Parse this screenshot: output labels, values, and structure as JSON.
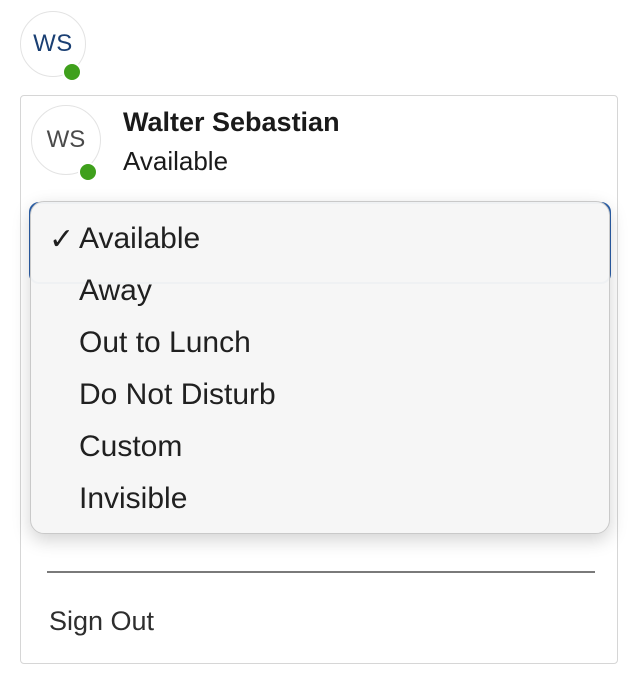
{
  "header": {
    "avatar_initials": "WS",
    "status_color": "#3fa01c"
  },
  "profile": {
    "avatar_initials": "WS",
    "name": "Walter Sebastian",
    "status": "Available"
  },
  "status_menu": {
    "selected": "Available",
    "check_glyph": "✓",
    "options": [
      "Available",
      "Away",
      "Out to Lunch",
      "Do Not Disturb",
      "Custom",
      "Invisible"
    ]
  },
  "footer": {
    "sign_out_label": "Sign Out"
  }
}
